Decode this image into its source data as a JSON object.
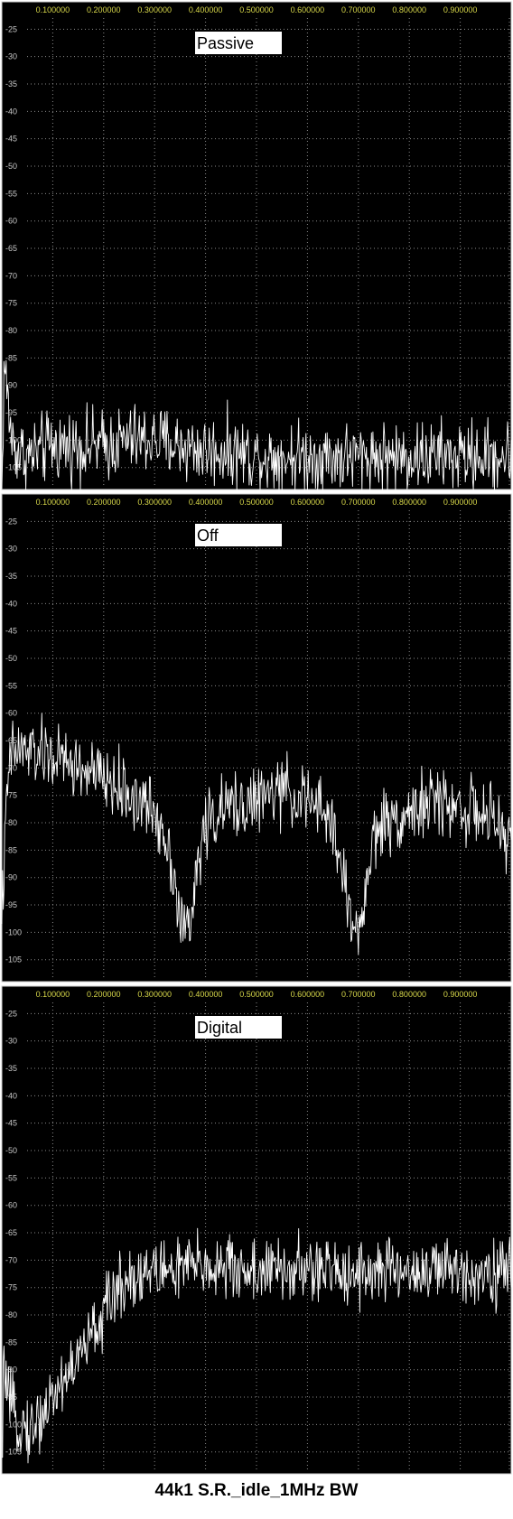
{
  "caption": "44k1 S.R._idle_1MHz BW",
  "colors": {
    "background": "#000000",
    "grid": "#8a8a8a",
    "trace": "#ffffff",
    "x_tick_text": "#d8d84a",
    "y_tick_text": "#c8c8c8",
    "label_box": "#ffffff"
  },
  "chart_data": [
    {
      "type": "line",
      "title": "Passive",
      "x_ticks": [
        "0.100000",
        "0.200000",
        "0.300000",
        "0.400000",
        "0.500000",
        "0.600000",
        "0.700000",
        "0.800000",
        "0.900000"
      ],
      "y_ticks": [
        "-25",
        "-30",
        "-35",
        "-40",
        "-45",
        "-50",
        "-55",
        "-60",
        "-65",
        "-70",
        "-75",
        "-80",
        "-85",
        "-90",
        "-95",
        "-100",
        "-105"
      ],
      "xlim": [
        0,
        1.0
      ],
      "ylim": [
        -109,
        -20
      ],
      "grid": true,
      "series": [
        {
          "x": [
            0.0,
            0.005,
            0.01,
            0.015,
            0.02,
            0.03,
            0.05,
            0.1,
            0.15,
            0.2,
            0.25,
            0.3,
            0.35,
            0.4,
            0.45,
            0.5,
            0.6,
            0.7,
            0.8,
            0.9,
            1.0
          ],
          "y": [
            -110,
            -85,
            -91,
            -96,
            -100,
            -102,
            -103,
            -101,
            -101,
            -101,
            -100,
            -100,
            -101,
            -102,
            -102,
            -103,
            -103,
            -103,
            -103,
            -103,
            -103
          ],
          "noise": 3.2
        }
      ]
    },
    {
      "type": "line",
      "title": "Off",
      "x_ticks": [
        "0.100000",
        "0.200000",
        "0.300000",
        "0.400000",
        "0.500000",
        "0.600000",
        "0.700000",
        "0.800000",
        "0.900000"
      ],
      "y_ticks": [
        "-25",
        "-30",
        "-35",
        "-40",
        "-45",
        "-50",
        "-55",
        "-60",
        "-65",
        "-70",
        "-75",
        "-80",
        "-85",
        "-90",
        "-95",
        "-100",
        "-105"
      ],
      "xlim": [
        0,
        1.0
      ],
      "ylim": [
        -109,
        -20
      ],
      "grid": true,
      "series": [
        {
          "x": [
            0.0,
            0.005,
            0.01,
            0.015,
            0.02,
            0.05,
            0.1,
            0.15,
            0.2,
            0.25,
            0.3,
            0.32,
            0.34,
            0.35,
            0.37,
            0.38,
            0.4,
            0.45,
            0.5,
            0.55,
            0.6,
            0.65,
            0.66,
            0.68,
            0.69,
            0.7,
            0.72,
            0.73,
            0.75,
            0.8,
            0.85,
            0.9,
            0.95,
            1.0
          ],
          "y": [
            -95,
            -88,
            -75,
            -70,
            -67,
            -67,
            -68,
            -70,
            -72,
            -75,
            -78,
            -82,
            -90,
            -98,
            -100,
            -90,
            -80,
            -77,
            -76,
            -74,
            -76,
            -80,
            -85,
            -95,
            -99,
            -100,
            -90,
            -82,
            -80,
            -78,
            -76,
            -77,
            -79,
            -83
          ],
          "noise": 3.0
        }
      ]
    },
    {
      "type": "line",
      "title": "Digital",
      "x_ticks": [
        "0.100000",
        "0.200000",
        "0.300000",
        "0.400000",
        "0.500000",
        "0.600000",
        "0.700000",
        "0.800000",
        "0.900000"
      ],
      "y_ticks": [
        "-25",
        "-30",
        "-35",
        "-40",
        "-45",
        "-50",
        "-55",
        "-60",
        "-65",
        "-70",
        "-75",
        "-80",
        "-85",
        "-90",
        "-95",
        "-100",
        "-105"
      ],
      "xlim": [
        0,
        1.0
      ],
      "ylim": [
        -109,
        -20
      ],
      "grid": true,
      "series": [
        {
          "x": [
            0.0,
            0.005,
            0.01,
            0.02,
            0.04,
            0.06,
            0.08,
            0.1,
            0.12,
            0.15,
            0.18,
            0.2,
            0.22,
            0.25,
            0.3,
            0.4,
            0.5,
            0.6,
            0.7,
            0.8,
            0.9,
            1.0
          ],
          "y": [
            -110,
            -85,
            -95,
            -98,
            -100,
            -101,
            -98,
            -95,
            -92,
            -88,
            -83,
            -80,
            -76,
            -73,
            -72,
            -71,
            -72,
            -72,
            -72,
            -72,
            -72,
            -72
          ],
          "noise": 3.0
        }
      ]
    }
  ]
}
